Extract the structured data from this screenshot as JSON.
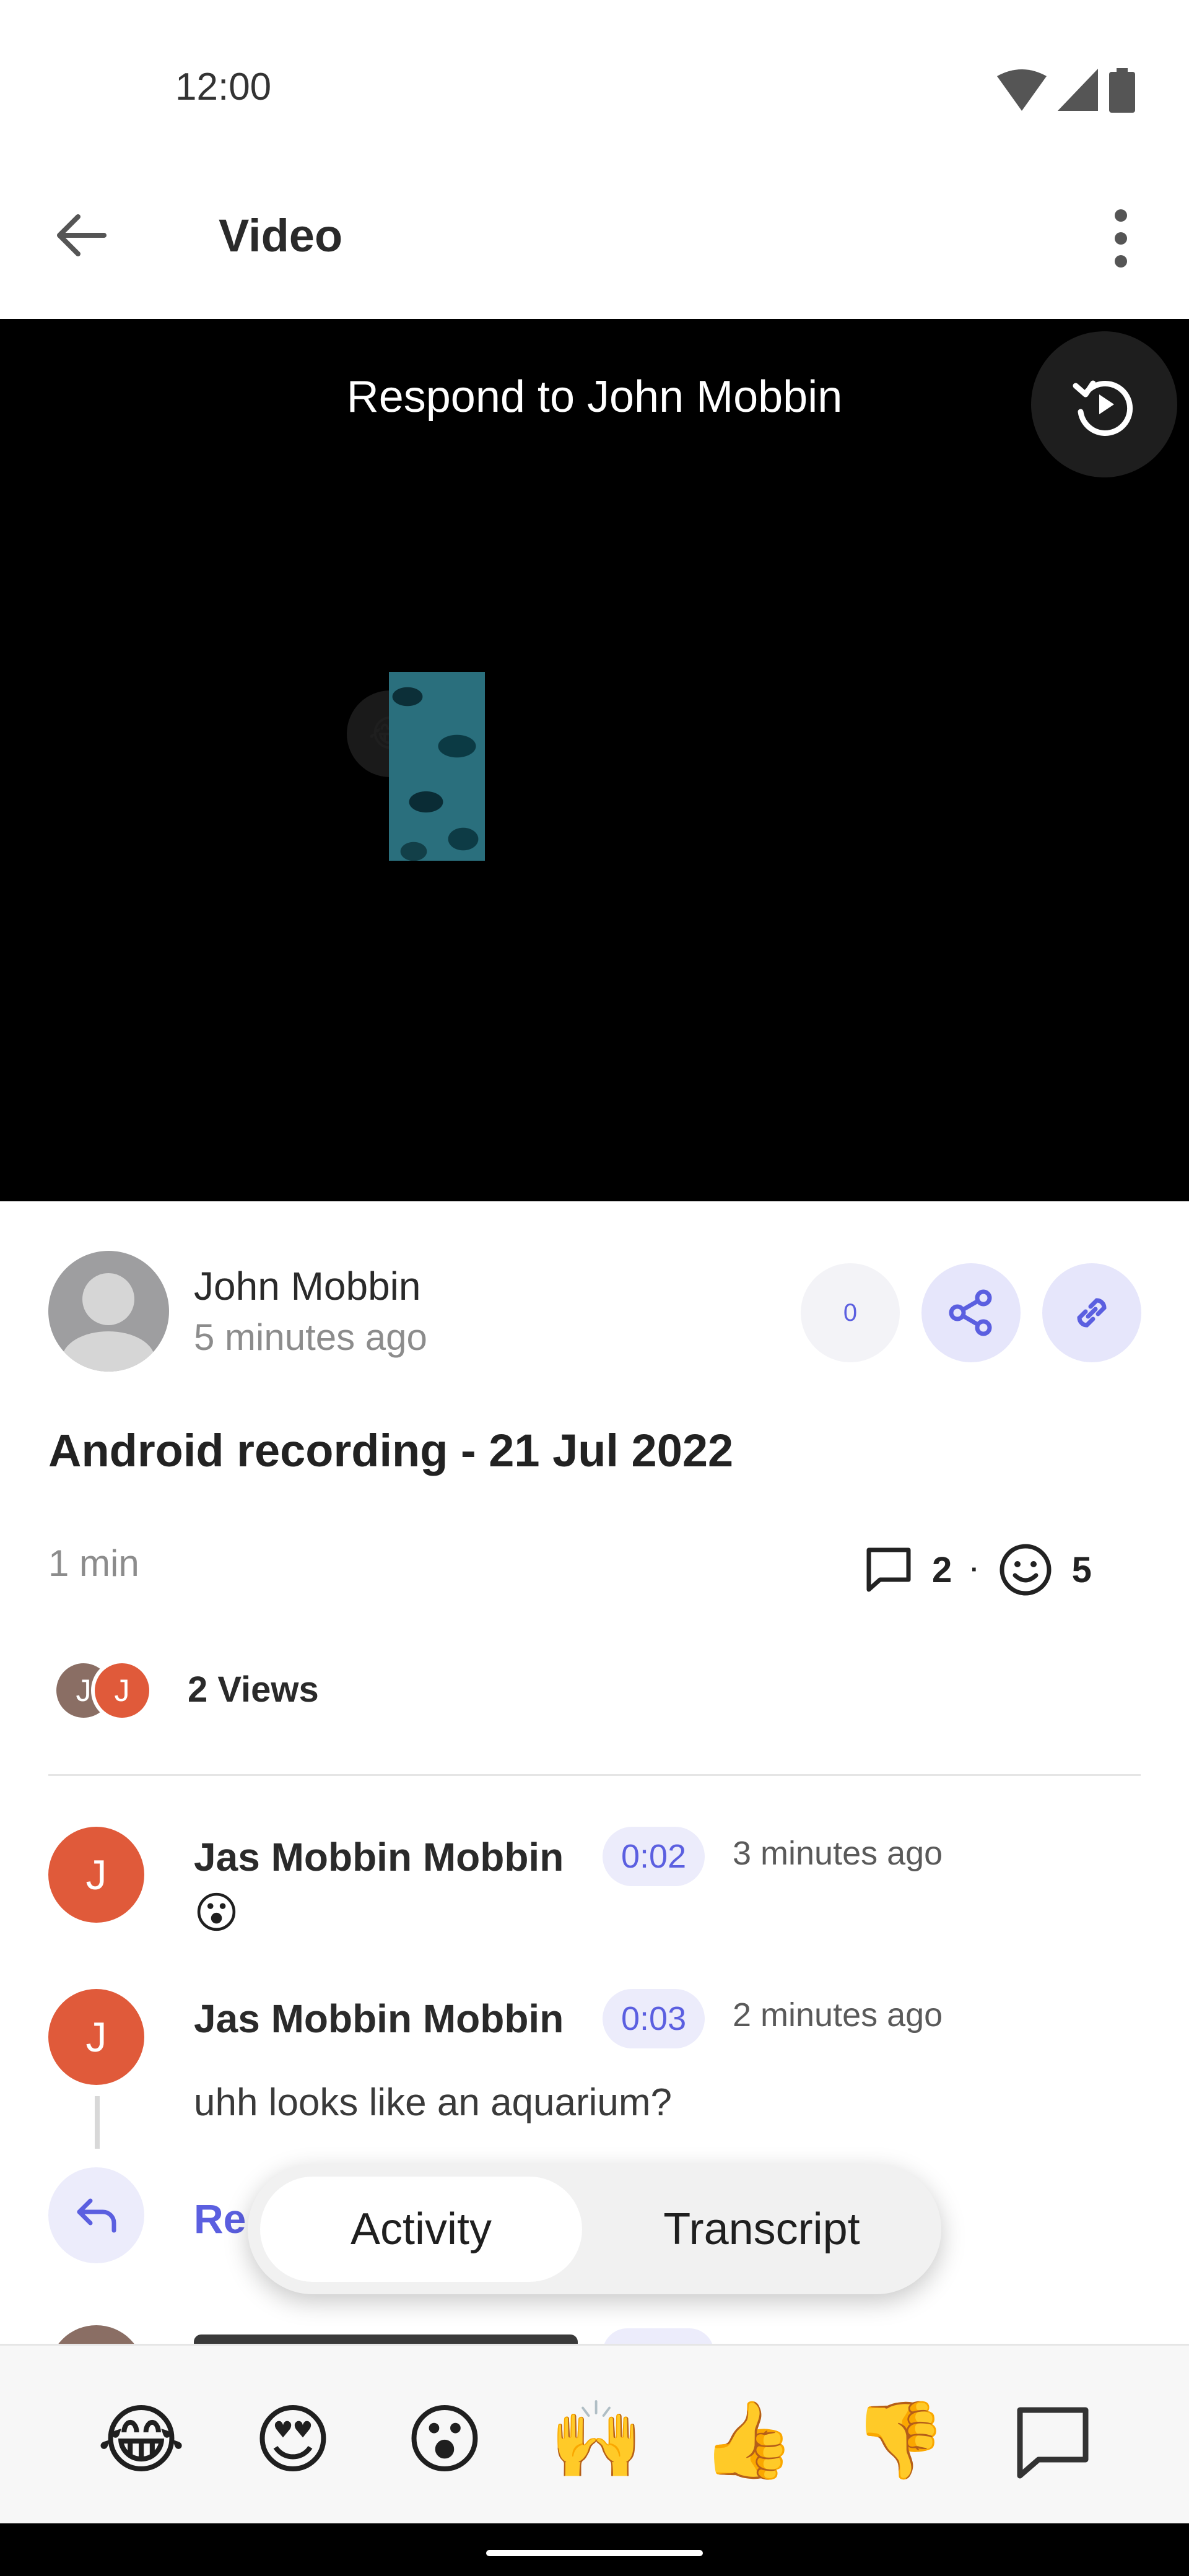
{
  "status_bar": {
    "time": "12:00"
  },
  "app_bar": {
    "title": "Video"
  },
  "video": {
    "overlay_title": "Respond to John Mobbin",
    "reaction_emoji": "😂"
  },
  "author": {
    "name": "John Mobbin",
    "posted": "5 minutes ago",
    "reaction_count": "0"
  },
  "recording": {
    "title": "Android recording - 21 Jul 2022",
    "duration": "1 min",
    "comments_count": "2",
    "separator": "·",
    "reactions_count": "5"
  },
  "views": {
    "avatars": [
      "J",
      "J"
    ],
    "label": "2 Views"
  },
  "comments": [
    {
      "initial": "J",
      "name": "Jas Mobbin Mobbin",
      "timestamp": "0:02",
      "time_ago": "3 minutes ago",
      "text": "😮"
    },
    {
      "initial": "J",
      "name": "Jas Mobbin Mobbin",
      "timestamp": "0:03",
      "time_ago": "2 minutes ago",
      "text": "uhh looks like an aquarium?"
    }
  ],
  "reply": {
    "label": "Re"
  },
  "tabs": {
    "activity": "Activity",
    "transcript": "Transcript"
  },
  "reactions": [
    "😂",
    "😍",
    "😮",
    "🙌",
    "👍",
    "👎"
  ],
  "colors": {
    "accent": "#5b5fe0",
    "avatar": "#e05a3a",
    "video_bg": "#000000"
  }
}
